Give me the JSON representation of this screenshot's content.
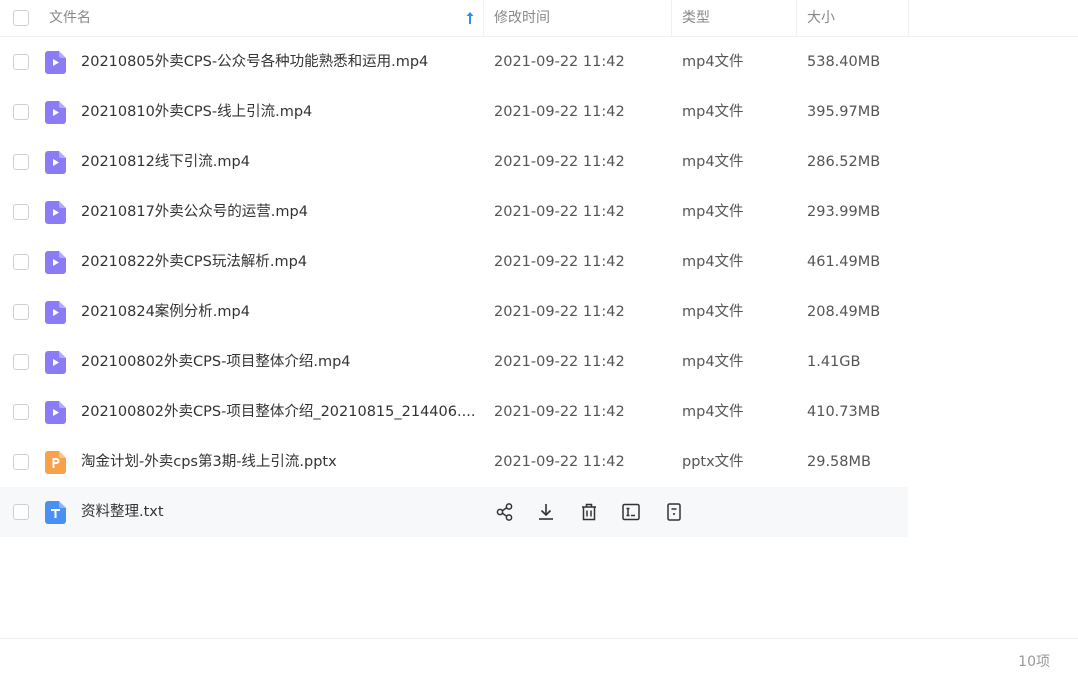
{
  "header": {
    "name_label": "文件名",
    "time_label": "修改时间",
    "type_label": "类型",
    "size_label": "大小",
    "sort_icon": "arrow-up-icon"
  },
  "files": [
    {
      "name": "20210805外卖CPS-公众号各种功能熟悉和运用.mp4",
      "time": "2021-09-22 11:42",
      "type": "mp4文件",
      "size": "538.40MB",
      "icon": "video"
    },
    {
      "name": "20210810外卖CPS-线上引流.mp4",
      "time": "2021-09-22 11:42",
      "type": "mp4文件",
      "size": "395.97MB",
      "icon": "video"
    },
    {
      "name": "20210812线下引流.mp4",
      "time": "2021-09-22 11:42",
      "type": "mp4文件",
      "size": "286.52MB",
      "icon": "video"
    },
    {
      "name": "20210817外卖公众号的运营.mp4",
      "time": "2021-09-22 11:42",
      "type": "mp4文件",
      "size": "293.99MB",
      "icon": "video"
    },
    {
      "name": "20210822外卖CPS玩法解析.mp4",
      "time": "2021-09-22 11:42",
      "type": "mp4文件",
      "size": "461.49MB",
      "icon": "video"
    },
    {
      "name": "20210824案例分析.mp4",
      "time": "2021-09-22 11:42",
      "type": "mp4文件",
      "size": "208.49MB",
      "icon": "video"
    },
    {
      "name": "202100802外卖CPS-项目整体介绍.mp4",
      "time": "2021-09-22 11:42",
      "type": "mp4文件",
      "size": "1.41GB",
      "icon": "video"
    },
    {
      "name": "202100802外卖CPS-项目整体介绍_20210815_214406....",
      "time": "2021-09-22 11:42",
      "type": "mp4文件",
      "size": "410.73MB",
      "icon": "video"
    },
    {
      "name": "淘金计划-外卖cps第3期-线上引流.pptx",
      "time": "2021-09-22 11:42",
      "type": "pptx文件",
      "size": "29.58MB",
      "icon": "ppt"
    },
    {
      "name": "资料整理.txt",
      "time": "",
      "type": "",
      "size": "",
      "icon": "txt",
      "hovered": true
    }
  ],
  "row_actions": [
    "share-icon",
    "download-icon",
    "delete-icon",
    "rename-icon",
    "more-icon"
  ],
  "colors": {
    "video": "#8b7cf6",
    "ppt": "#f7a14a",
    "txt": "#4a90f0",
    "sort_arrow": "#2f8cf0"
  },
  "footer": {
    "count": "10项"
  }
}
